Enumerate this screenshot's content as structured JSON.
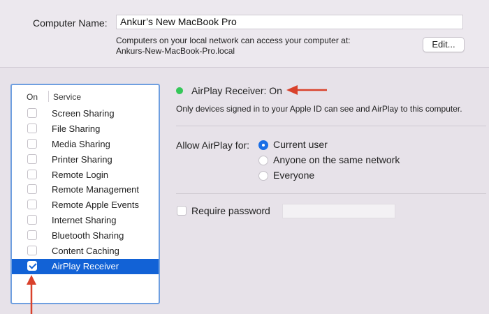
{
  "computer_name": {
    "label": "Computer Name:",
    "value": "Ankur’s New MacBook Pro",
    "description_line1": "Computers on your local network can access your computer at:",
    "description_line2": "Ankurs-New-MacBook-Pro.local",
    "edit_label": "Edit..."
  },
  "services": {
    "header_on": "On",
    "header_service": "Service",
    "items": [
      {
        "label": "Screen Sharing",
        "checked": false
      },
      {
        "label": "File Sharing",
        "checked": false
      },
      {
        "label": "Media Sharing",
        "checked": false
      },
      {
        "label": "Printer Sharing",
        "checked": false
      },
      {
        "label": "Remote Login",
        "checked": false
      },
      {
        "label": "Remote Management",
        "checked": false
      },
      {
        "label": "Remote Apple Events",
        "checked": false
      },
      {
        "label": "Internet Sharing",
        "checked": false
      },
      {
        "label": "Bluetooth Sharing",
        "checked": false
      },
      {
        "label": "Content Caching",
        "checked": false
      },
      {
        "label": "AirPlay Receiver",
        "checked": true,
        "selected": true
      }
    ]
  },
  "status": {
    "text": "AirPlay Receiver: On",
    "description": "Only devices signed in to your Apple ID can see and AirPlay to this computer.",
    "dot_color": "#35c759"
  },
  "allow": {
    "label": "Allow AirPlay for:",
    "options": [
      {
        "label": "Current user",
        "selected": true
      },
      {
        "label": "Anyone on the same network",
        "selected": false
      },
      {
        "label": "Everyone",
        "selected": false
      }
    ]
  },
  "password": {
    "label": "Require password",
    "checked": false,
    "value": ""
  },
  "colors": {
    "selection": "#1262d6",
    "panel_border": "#6f9fe0",
    "annotation_arrow": "#d9412b"
  }
}
